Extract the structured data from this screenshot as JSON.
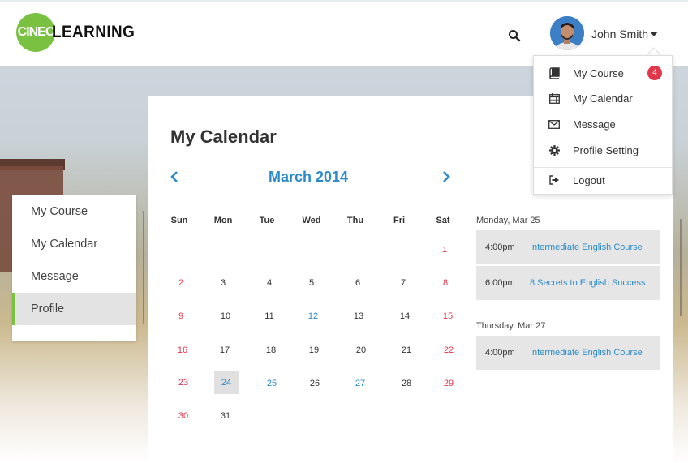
{
  "header": {
    "logo_mark": "CINEC",
    "logo_word": "LEARNING",
    "user_name": "John Smith"
  },
  "sidebar": {
    "items": [
      {
        "label": "My Course"
      },
      {
        "label": "My Calendar"
      },
      {
        "label": "Message"
      },
      {
        "label": "Profile"
      }
    ]
  },
  "main": {
    "title": "My Calendar",
    "month": "March 2014",
    "weekdays": [
      "Sun",
      "Mon",
      "Tue",
      "Wed",
      "Thu",
      "Fri",
      "Sat"
    ],
    "days": [
      "1",
      "2",
      "3",
      "4",
      "5",
      "6",
      "7",
      "8",
      "9",
      "10",
      "11",
      "12",
      "13",
      "14",
      "15",
      "16",
      "17",
      "18",
      "19",
      "20",
      "21",
      "22",
      "23",
      "24",
      "25",
      "26",
      "27",
      "28",
      "29",
      "30",
      "31"
    ]
  },
  "events": {
    "groups": [
      {
        "date": "Monday, Mar 25",
        "items": [
          {
            "time": "4:00pm",
            "title": "Intermediate English Course"
          },
          {
            "time": "6:00pm",
            "title": "8 Secrets to English Success"
          }
        ]
      },
      {
        "date": "Thursday, Mar 27",
        "items": [
          {
            "time": "4:00pm",
            "title": "Intermediate English Course"
          }
        ]
      }
    ]
  },
  "dropdown": {
    "items": [
      {
        "label": "My Course",
        "icon": "book-icon",
        "badge": "4"
      },
      {
        "label": "My Calendar",
        "icon": "calendar-icon"
      },
      {
        "label": "Message",
        "icon": "envelope-icon"
      },
      {
        "label": "Profile Setting",
        "icon": "gear-icon"
      },
      {
        "label": "Logout",
        "icon": "logout-icon"
      }
    ]
  },
  "colors": {
    "brand_green": "#7ac142",
    "accent_blue": "#2d8bca",
    "weekend_red": "#e2364b"
  }
}
